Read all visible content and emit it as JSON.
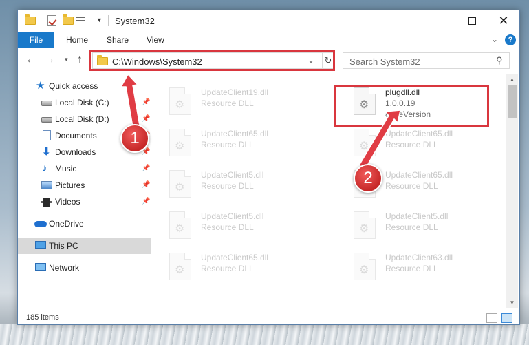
{
  "window": {
    "title": "System32",
    "minimize_glyph": "",
    "maximize_glyph": "",
    "close_glyph": "✕"
  },
  "ribbon": {
    "tabs": [
      "File",
      "Home",
      "Share",
      "View"
    ],
    "help_glyph": "?"
  },
  "nav": {
    "back_glyph": "←",
    "forward_glyph": "→",
    "recent_glyph": "▾",
    "up_glyph": "↑",
    "address": "C:\\Windows\\System32",
    "address_dropdown_glyph": "⌄",
    "refresh_glyph": "↻",
    "search_placeholder": "Search System32",
    "search_glyph": "⚲"
  },
  "sidebar": {
    "items": [
      {
        "label": "Quick access",
        "icon": "star-icon",
        "pinned": false
      },
      {
        "label": "Local Disk (C:)",
        "icon": "disk-icon",
        "pinned": true
      },
      {
        "label": "Local Disk (D:)",
        "icon": "disk-icon",
        "pinned": true
      },
      {
        "label": "Documents",
        "icon": "documents-icon",
        "pinned": true
      },
      {
        "label": "Downloads",
        "icon": "downloads-icon",
        "pinned": true
      },
      {
        "label": "Music",
        "icon": "music-icon",
        "pinned": true
      },
      {
        "label": "Pictures",
        "icon": "pictures-icon",
        "pinned": true
      },
      {
        "label": "Videos",
        "icon": "videos-icon",
        "pinned": true
      },
      {
        "label": "OneDrive",
        "icon": "onedrive-icon",
        "pinned": false
      },
      {
        "label": "This PC",
        "icon": "this-pc-icon",
        "pinned": false,
        "selected": true
      },
      {
        "label": "Network",
        "icon": "network-icon",
        "pinned": false
      }
    ]
  },
  "files": [
    {
      "name": "UpdateClient19.dll",
      "type": "Resource DLL",
      "faded": true
    },
    {
      "name": "plugdll.dll",
      "version": "1.0.0.19",
      "type": "8FileVersion",
      "faded": false
    },
    {
      "name": "UpdateClient65.dll",
      "type": "Resource DLL",
      "faded": true
    },
    {
      "name": "UpdateClient65.dll",
      "type": "Resource DLL",
      "faded": true
    },
    {
      "name": "UpdateClient5.dll",
      "type": "Resource DLL",
      "faded": true
    },
    {
      "name": "UpdateClient65.dll",
      "type": "Resource DLL",
      "faded": true
    },
    {
      "name": "UpdateClient5.dll",
      "type": "Resource DLL",
      "faded": true
    },
    {
      "name": "UpdateClient5.dll",
      "type": "Resource DLL",
      "faded": true
    },
    {
      "name": "UpdateClient65.dll",
      "type": "Resource DLL",
      "faded": true
    },
    {
      "name": "UpdateClient63.dll",
      "type": "Resource DLL",
      "faded": true
    }
  ],
  "status": {
    "item_count": "185 items"
  },
  "annotations": {
    "marker_1": "1",
    "marker_2": "2",
    "color": "#d9363e"
  },
  "colors": {
    "accent": "#1979ca",
    "selection": "#d9d9d9"
  }
}
